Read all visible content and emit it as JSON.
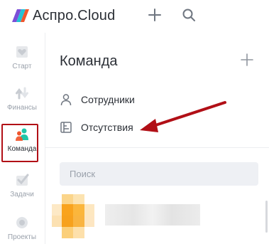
{
  "app": {
    "brand": "Аспро.Cloud",
    "accent": "#1fc7a8",
    "highlight_color": "#b10f16"
  },
  "topbar": {
    "plus_icon": "plus-icon",
    "search_icon": "search-icon"
  },
  "nav": {
    "items": [
      {
        "label": "Старт",
        "icon": "heart-icon"
      },
      {
        "label": "Финансы",
        "icon": "finance-arrows-icon"
      },
      {
        "label": "Команда",
        "icon": "team-icon",
        "active": true
      },
      {
        "label": "Задачи",
        "icon": "check-icon"
      },
      {
        "label": "Проекты",
        "icon": "projects-icon"
      }
    ]
  },
  "panel": {
    "title": "Команда",
    "add_icon": "plus-icon",
    "menu": [
      {
        "label": "Сотрудники",
        "icon": "person-icon"
      },
      {
        "label": "Отсутствия",
        "icon": "absence-calendar-icon"
      }
    ],
    "search": {
      "placeholder": "Поиск"
    }
  }
}
